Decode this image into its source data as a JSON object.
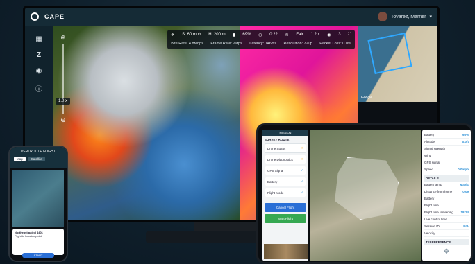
{
  "monitor": {
    "app_name": "CAPE",
    "user_name": "Tovarez, Marner",
    "telemetry": {
      "speed": "S: 60 mph",
      "altitude": "H: 200 m",
      "battery": "69%",
      "time": "0:22",
      "signal": "Fair",
      "zoom": "1.2 x",
      "count": "3",
      "bitrate": "Bite Rate: 4.8Mbps",
      "framerate": "Frame Rate: 29fps",
      "latency": "Latency: 146ms",
      "resolution": "Resolution: 720p",
      "packetloss": "Packet Loss: 0.0%"
    },
    "zoom_badge": "1.0 x",
    "map_credit": "Google"
  },
  "phone": {
    "title": "PERI ROUTE FLIGHT",
    "tab_map": "Map",
    "tab_satellite": "Satellite",
    "card_title": "Northeast patrol 4401",
    "card_line": "Flight to location point",
    "btn_label": "START"
  },
  "tablet": {
    "panel_title": "MISSION",
    "panel_subtitle": "SURVEY ROUTE",
    "checklist": [
      {
        "label": "Drone Status",
        "state": "warn"
      },
      {
        "label": "Drone Diagnostics",
        "state": "warn"
      },
      {
        "label": "GPS Signal",
        "state": "ok"
      },
      {
        "label": "Battery",
        "state": "ok"
      },
      {
        "label": "Flight Mode",
        "state": "ok"
      }
    ],
    "btn_cancel": "Cancel Flight",
    "btn_start": "Start Flight",
    "stats": [
      {
        "k": "Battery",
        "v": "98%"
      },
      {
        "k": "Altitude",
        "v": "0.0ft"
      },
      {
        "k": "Signal strength",
        "v": ""
      },
      {
        "k": "Wind",
        "v": ""
      },
      {
        "k": "GPS signal",
        "v": ""
      },
      {
        "k": "Speed",
        "v": "0.0mph"
      }
    ],
    "details_title": "DETAILS",
    "details": [
      {
        "k": "Battery temp",
        "v": "Mavic"
      },
      {
        "k": "Distance from home",
        "v": "0.09"
      },
      {
        "k": "Battery",
        "v": ""
      },
      {
        "k": "Flight time",
        "v": ""
      },
      {
        "k": "Flight time remaining",
        "v": "18:24"
      },
      {
        "k": "Live control time",
        "v": ""
      },
      {
        "k": "Session ID",
        "v": "N/A"
      },
      {
        "k": "Velocity",
        "v": ""
      }
    ],
    "telepresence_title": "TELEPRESENCE"
  }
}
